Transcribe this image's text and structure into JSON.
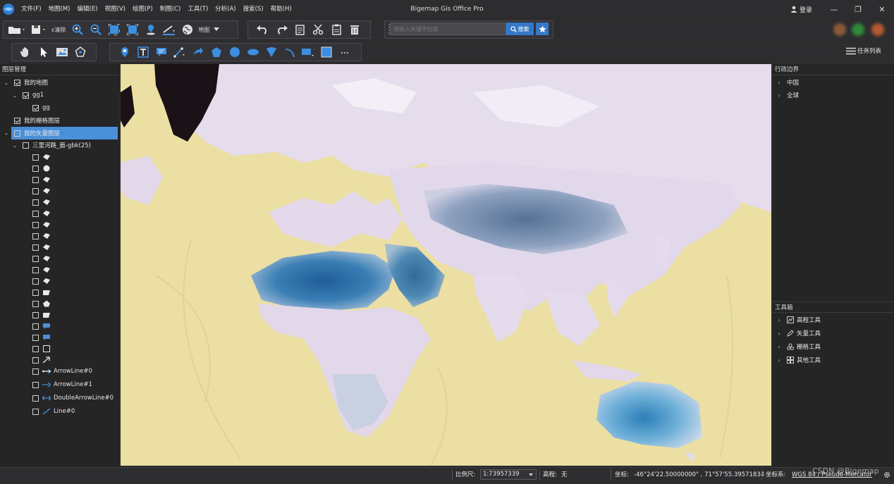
{
  "app": {
    "title": "Bigemap Gis Office Pro",
    "login_label": "登录"
  },
  "menu": [
    "文件(F)",
    "地图(M)",
    "编辑(E)",
    "视图(V)",
    "绘图(P)",
    "制图(C)",
    "工具(T)",
    "分析(A)",
    "搜索(S)",
    "帮助(H)"
  ],
  "toolbar": {
    "clear_label": "ε清除",
    "map_label": "地图",
    "search_placeholder": "请输入关键字检索",
    "search_button": "搜索",
    "tasklist_label": "任务列表"
  },
  "layers_panel": {
    "title": "图层管理",
    "rows": [
      {
        "label": "我的地图",
        "checked": true
      },
      {
        "label": "gg1",
        "checked": true
      },
      {
        "label": "gg",
        "checked": true
      },
      {
        "label": "我的栅格图层",
        "checked": true
      },
      {
        "label": "我的矢量图层",
        "checked": false
      },
      {
        "label": "三里河路_面-gbk(25)",
        "checked": false
      }
    ],
    "features": [
      {
        "label": "ArrowLine#0"
      },
      {
        "label": "ArrowLine#1"
      },
      {
        "label": "DoubleArrowLine#0"
      },
      {
        "label": "Line#0"
      }
    ]
  },
  "admin_panel": {
    "title": "行政边界",
    "items": [
      "中国",
      "全球"
    ]
  },
  "toolbox_panel": {
    "title": "工具箱",
    "items": [
      "高程工具",
      "矢量工具",
      "栅格工具",
      "其他工具"
    ]
  },
  "status": {
    "scale_label": "比例尺:",
    "scale_value": "1:73957339",
    "elevation_label": "高程:",
    "elevation_value": "无",
    "coord_label": "坐标:",
    "coord_value": "-46°24'22.50000000\" , 71°57'55.39571834",
    "crs_label": "坐标系:",
    "crs_value": "WGS 84 / Pseudo-Mercator",
    "watermark": "CSDN @Bigemap"
  },
  "colors": {
    "accent": "#3578c8",
    "selection": "#4a90d9",
    "panel_bg": "#252526",
    "map_sea": "#e9dea0",
    "map_land": "#e4dcec",
    "map_desert": "#2a6aa0"
  }
}
